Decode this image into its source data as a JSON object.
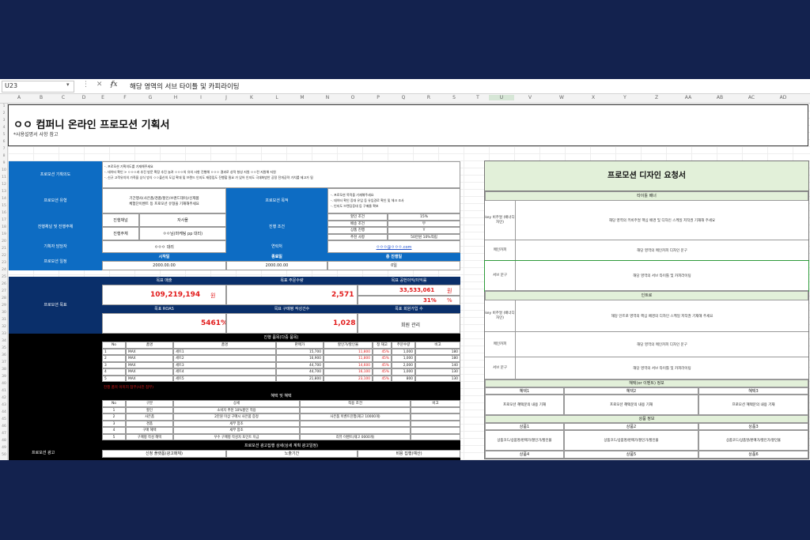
{
  "formula_bar": {
    "name_box": "U23",
    "fx": "fx",
    "content": "해당 영역의 서브 타이틀 및 카피라이팅"
  },
  "columns": [
    "A",
    "B",
    "C",
    "D",
    "E",
    "F",
    "G",
    "H",
    "I",
    "J",
    "K",
    "L",
    "M",
    "N",
    "O",
    "P",
    "Q",
    "R",
    "S",
    "T",
    "U",
    "V",
    "W",
    "X",
    "Y",
    "Z",
    "AA",
    "AB",
    "AC",
    "AD"
  ],
  "rows": [
    "1",
    "2",
    "3",
    "4",
    "5",
    "6",
    "7",
    "8",
    "9",
    "10",
    "11",
    "12",
    "13",
    "14",
    "15",
    "16",
    "17",
    "18",
    "19",
    "20",
    "21",
    "22",
    "23",
    "24",
    "25",
    "26",
    "27",
    "28",
    "29",
    "30",
    "31",
    "32",
    "33",
    "34",
    "35",
    "36",
    "37",
    "38",
    "39",
    "40",
    "41",
    "42",
    "43",
    "44",
    "45",
    "46",
    "47",
    "48",
    "49",
    "50"
  ],
  "document": {
    "title": "ㅇㅇ 컴퍼니 온라인 프로모션 기획서",
    "note": "*사용설명서 사항 참고"
  },
  "plan": {
    "intent_label": "프로모션 기획의도",
    "intent_lines": [
      "-. 프로모션 기획의도를 기재해주세요",
      "-. 데이터 확인 > ㅇㅇㅇ과 추진 방문 확장 추진 늘려 ㅇㅇㅇ의 유의 사항 진행해 ㅇㅇㅇ 결과로 성적 형성 지원 ㅇㅇ전 지원해 지원",
      "-. 신규 고객유치의 가족을 상식 방식 ㅇㅇ출신의 도입 확대 및 브랜드 인지도 재정립도 진행할 필요 가 있어 인지도 극대화방안 공정 전개공략 가치를 제고가 됨"
    ],
    "type_label": "프로모션 유형",
    "type_lines": [
      "기간행사(사은품/경품/할인/브랜드데이)/신제품",
      "체험단이벤트 등 프로모션 유형을 기재해주세요"
    ],
    "goal_label": "프로모션 목적",
    "goal_lines": [
      "-. 프로모션 목적을 기재해주세요",
      "-. 데이터 확인 증대 유입 등 유입경로 확인 및 체크 조사",
      "-. 인지도 브랜딩증대 등 구매율 확보"
    ],
    "channel_label": "진행채널 및 진행주체",
    "channel_rows": [
      {
        "k": "진행채널",
        "v": "자사몰"
      },
      {
        "k": "진행주체",
        "v": "ㅇㅇ님(마케팅 pp 대리)"
      }
    ],
    "cond_label": "진행 조건",
    "cond_rows": [
      {
        "k": "할인 조건",
        "v": "15%"
      },
      {
        "k": "배송 조건",
        "v": "무"
      },
      {
        "k": "상품 진행",
        "v": "Y"
      },
      {
        "k": "추천 사항",
        "v": "50만원 10%적립"
      }
    ],
    "planner_label": "기획자 담당자",
    "planner_value": "ㅇㅇㅇ 대리",
    "contact_label": "연락처",
    "contact_value": "ㅇㅇㅇ@ㅇㅇㅇ.com",
    "schedule_label": "프로모션 일정",
    "schedule_headers": [
      "시작일",
      "종료일",
      "총 진행일"
    ],
    "schedule_values": [
      "2000.00.00",
      "2000.00.00",
      "0일"
    ]
  },
  "result": {
    "label": "프로모션 목표",
    "h1": "목표 매출",
    "v1": "109,219,194",
    "u1": "원",
    "h2": "목표 주문수량",
    "v2": "2,571",
    "h3": "목표 공헌이익/이익률",
    "v3": "33,533,061",
    "u3": "원",
    "v3b": "31%",
    "u3b": "%",
    "h4": "목표 ROAS",
    "v4": "5461%",
    "h5": "목표 구매평 작성건수",
    "v5": "1,028",
    "h6": "목표 회원가입 수",
    "v6": "회원 관리"
  },
  "products": {
    "title": "진행 품목(다중 품목)",
    "headers": [
      "No",
      "품명",
      "품명",
      "판매가",
      "할인가/할인율",
      "정 재고",
      "주문수량",
      "비고"
    ],
    "rows": [
      [
        "1",
        "MAX",
        "세트1",
        "15,700",
        "11,800",
        "45%",
        "1,000",
        "180"
      ],
      [
        "2",
        "MAX",
        "세트2",
        "16,900",
        "11,800",
        "45%",
        "1,000",
        "180"
      ],
      [
        "3",
        "MAX",
        "세트3",
        "44,700",
        "14,600",
        "45%",
        "2,000",
        "140"
      ],
      [
        "4",
        "MAX",
        "세트4",
        "44,700",
        "16,100",
        "45%",
        "1,000",
        "130"
      ],
      [
        "5",
        "MAX",
        "세트5",
        "21,800",
        "23,100",
        "45%",
        "800",
        "130"
      ]
    ],
    "footnote": "진행 품목 이미지 첨부(사진 첨부)"
  },
  "benefits": {
    "title": "혜택 및 혜택",
    "headers": [
      "No",
      "구분",
      "상세",
      "적용 조건",
      "비고"
    ],
    "rows": [
      [
        "1",
        "할인",
        "소비자 추천 10%할인 적용",
        ""
      ],
      [
        "2",
        "사은품",
        "2만원 이상 구매시 사은품 증정",
        "사은품 이벤트진행(재고 10000개)"
      ],
      [
        "3",
        "경품",
        "세부 참조",
        ""
      ],
      [
        "4",
        "구매 혜택",
        "세부 참조",
        ""
      ],
      [
        "5",
        "구매평 작성 혜택",
        "우수 구매평 작성자 포인트 지급",
        "리뷰 이벤트(재고 0000개)"
      ]
    ]
  },
  "ad": {
    "title": "프로모션 광고집행 상세(상세 계획 광고일정)",
    "label": "프로모션 광고",
    "headers": [
      "신청 플랫폼(광고매체)",
      "노출기간",
      "비용 집행(예산)"
    ]
  },
  "design": {
    "title": "프로모션 디자인 요청서",
    "sec1": "타이틀 배너",
    "sec1_rows": [
      {
        "label": "key 비주얼 (배너디자인)",
        "text": "해당 영역의 키비주얼 핵심 배경 및 디자인 스케일 저작권 기재해 주세요"
      },
      {
        "label": "메인카피",
        "text": "해당 영역의 메인카피 디자인 문구"
      },
      {
        "label": "서브 문구",
        "text": "해당 영역의 서브 타이틀 및 카피라이팅"
      }
    ],
    "sec2": "인트로",
    "sec2_rows": [
      {
        "label": "key 비주얼 (배너디자인)",
        "text": "해당 인트로 영역의 핵심 배경의 디자인 스케일 저작권 기재해 주세요"
      },
      {
        "label": "메인카피",
        "text": "해당 영역의 메인카피 디자인 문구"
      },
      {
        "label": "서브 문구",
        "text": "해당 영역의 서브 타이틀 및 카피라이팅"
      }
    ],
    "sec3": "혜택(or 이벤트) 정보",
    "sec3_heads": [
      "혜택1",
      "혜택2",
      "혜택3"
    ],
    "sec3_vals": [
      "프로모션 혜택문의 내용 기재",
      "프로모션 혜택문의 내용 기재",
      "프로모션 혜택문의 내용 기재"
    ],
    "sec4": "상품 정보",
    "sec4_heads": [
      "상품1",
      "상품2",
      "상품3"
    ],
    "sec4_vals": [
      "상품코드/상품명/판매가/할인가/할인율",
      "상품코드/상품명/판매가/할인가/할인율",
      "상품코드/상품명/판매가/할인가/할인율"
    ],
    "sec4_heads2": [
      "상품4",
      "상품5",
      "상품6"
    ]
  }
}
